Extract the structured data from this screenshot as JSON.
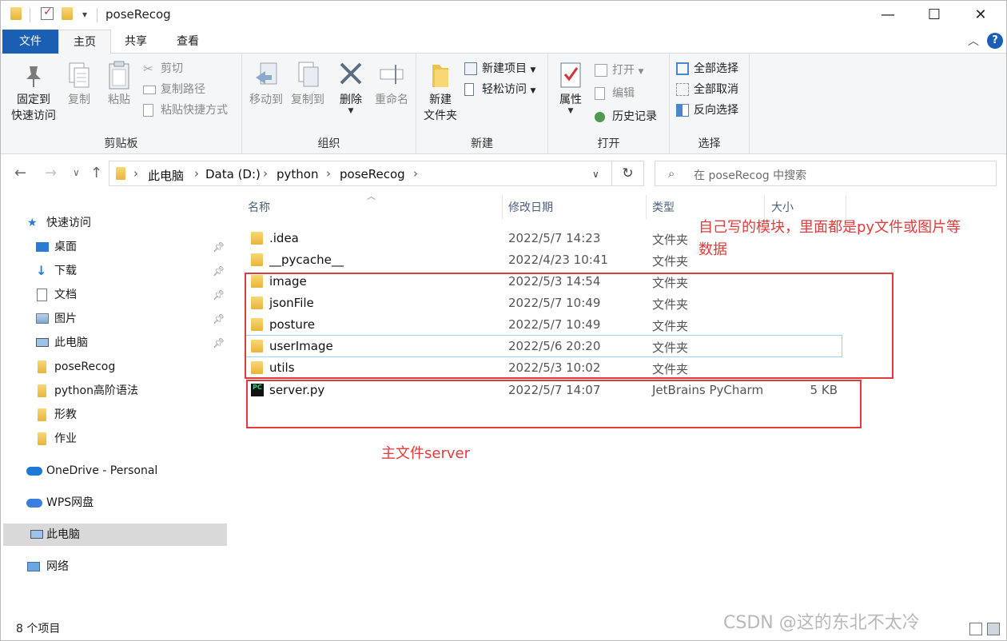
{
  "window": {
    "title": "poseRecog",
    "quick_access_arrow": "▾",
    "controls": {
      "minimize": "—",
      "maximize": "☐",
      "close": "✕"
    }
  },
  "ribbon_tabs": {
    "file": "文件",
    "home": "主页",
    "share": "共享",
    "view": "查看",
    "collapse": "︿",
    "help": "?"
  },
  "ribbon": {
    "clipboard": {
      "label": "剪贴板",
      "pin": "固定到\n快速访问",
      "pin_l1": "固定到",
      "pin_l2": "快速访问",
      "copy": "复制",
      "paste": "粘贴",
      "cut": "剪切",
      "copy_path": "复制路径",
      "paste_shortcut": "粘贴快捷方式"
    },
    "organize": {
      "label": "组织",
      "move_to": "移动到",
      "copy_to": "复制到",
      "delete": "删除",
      "rename": "重命名"
    },
    "new": {
      "label": "新建",
      "new_folder_l1": "新建",
      "new_folder_l2": "文件夹",
      "new_item": "新建项目",
      "easy_access": "轻松访问"
    },
    "open": {
      "label": "打开",
      "properties": "属性",
      "open": "打开",
      "edit": "编辑",
      "history": "历史记录"
    },
    "select": {
      "label": "选择",
      "select_all": "全部选择",
      "select_none": "全部取消",
      "invert": "反向选择"
    }
  },
  "address": {
    "breadcrumbs": [
      "此电脑",
      "Data (D:)",
      "python",
      "poseRecog"
    ],
    "search_placeholder": "在 poseRecog 中搜索"
  },
  "nav_pane": {
    "quick_access": "快速访问",
    "items": [
      {
        "label": "桌面",
        "pinned": true
      },
      {
        "label": "下载",
        "pinned": true
      },
      {
        "label": "文档",
        "pinned": true
      },
      {
        "label": "图片",
        "pinned": true
      },
      {
        "label": "此电脑",
        "pinned": true
      },
      {
        "label": "poseRecog",
        "pinned": false
      },
      {
        "label": "python高阶语法",
        "pinned": false
      },
      {
        "label": "形教",
        "pinned": false
      },
      {
        "label": "作业",
        "pinned": false
      }
    ],
    "onedrive": "OneDrive - Personal",
    "wps": "WPS网盘",
    "this_pc": "此电脑",
    "network": "网络"
  },
  "columns": {
    "name": "名称",
    "date": "修改日期",
    "type": "类型",
    "size": "大小"
  },
  "files": [
    {
      "name": ".idea",
      "date": "2022/5/7 14:23",
      "type": "文件夹",
      "size": ""
    },
    {
      "name": "__pycache__",
      "date": "2022/4/23 10:41",
      "type": "文件夹",
      "size": ""
    },
    {
      "name": "image",
      "date": "2022/5/3 14:54",
      "type": "文件夹",
      "size": ""
    },
    {
      "name": "jsonFile",
      "date": "2022/5/7 10:49",
      "type": "文件夹",
      "size": ""
    },
    {
      "name": "posture",
      "date": "2022/5/7 10:49",
      "type": "文件夹",
      "size": ""
    },
    {
      "name": "userImage",
      "date": "2022/5/6 20:20",
      "type": "文件夹",
      "size": ""
    },
    {
      "name": "utils",
      "date": "2022/5/3 10:02",
      "type": "文件夹",
      "size": ""
    },
    {
      "name": "server.py",
      "date": "2022/5/7 14:07",
      "type": "JetBrains PyCharm",
      "size": "5 KB"
    }
  ],
  "annotations": {
    "modules_l1": "自己写的模块，里面都是py文件或图片等",
    "modules_l2": "数据",
    "main_file": "主文件server",
    "color": "#e23b3b"
  },
  "status": {
    "count": "8 个项目"
  },
  "watermark": "CSDN @这的东北不太冷"
}
